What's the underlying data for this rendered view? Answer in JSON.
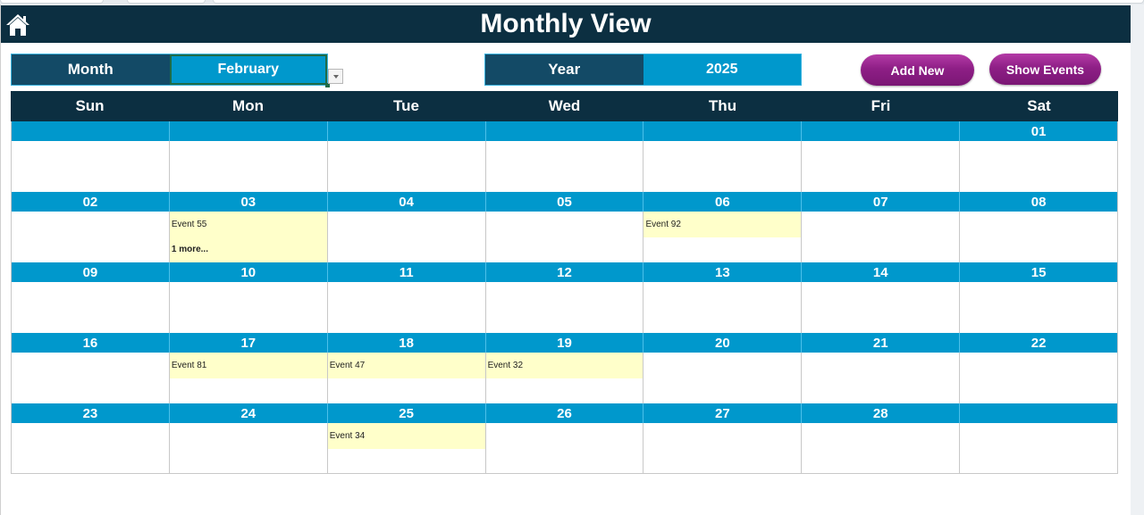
{
  "header": {
    "title": "Monthly View",
    "home_icon": "home-icon"
  },
  "controls": {
    "month_label": "Month",
    "month_value": "February",
    "year_label": "Year",
    "year_value": "2025",
    "add_new_label": "Add New",
    "show_events_label": "Show Events"
  },
  "calendar": {
    "weekdays": [
      "Sun",
      "Mon",
      "Tue",
      "Wed",
      "Thu",
      "Fri",
      "Sat"
    ],
    "weeks": [
      [
        {
          "day": ""
        },
        {
          "day": ""
        },
        {
          "day": ""
        },
        {
          "day": ""
        },
        {
          "day": ""
        },
        {
          "day": ""
        },
        {
          "day": "01"
        }
      ],
      [
        {
          "day": "02"
        },
        {
          "day": "03",
          "events": [
            "Event 55"
          ],
          "more": "1 more..."
        },
        {
          "day": "04"
        },
        {
          "day": "05"
        },
        {
          "day": "06",
          "events": [
            "Event 92"
          ]
        },
        {
          "day": "07"
        },
        {
          "day": "08"
        }
      ],
      [
        {
          "day": "09"
        },
        {
          "day": "10"
        },
        {
          "day": "11"
        },
        {
          "day": "12"
        },
        {
          "day": "13"
        },
        {
          "day": "14"
        },
        {
          "day": "15"
        }
      ],
      [
        {
          "day": "16"
        },
        {
          "day": "17",
          "events": [
            "Event 81"
          ]
        },
        {
          "day": "18",
          "events": [
            "Event 47"
          ]
        },
        {
          "day": "19",
          "events": [
            "Event 32"
          ]
        },
        {
          "day": "20"
        },
        {
          "day": "21"
        },
        {
          "day": "22"
        }
      ],
      [
        {
          "day": "23"
        },
        {
          "day": "24"
        },
        {
          "day": "25",
          "events": [
            "Event 34"
          ]
        },
        {
          "day": "26"
        },
        {
          "day": "27"
        },
        {
          "day": "28"
        },
        {
          "day": ""
        }
      ]
    ]
  },
  "colors": {
    "header_dark": "#0c2f41",
    "label_navy": "#134a66",
    "accent_blue": "#0098cc",
    "event_bg": "#ffffca",
    "button_magenta": "#8e1f86"
  }
}
